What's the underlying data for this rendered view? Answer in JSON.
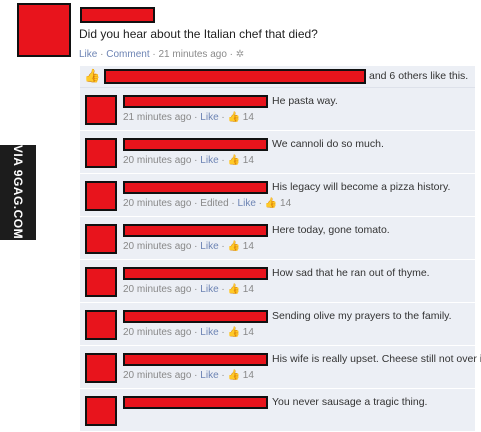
{
  "post": {
    "text": "Did you hear about the Italian chef that died?",
    "like_label": "Like",
    "comment_label": "Comment",
    "time": "21 minutes ago"
  },
  "likes_bar": {
    "others_text": "and 6 others like this."
  },
  "watermark": "VIA 9GAG.COM",
  "comments": [
    {
      "text": "He pasta way.",
      "time": "21 minutes ago",
      "like_label": "Like",
      "like_count": "14"
    },
    {
      "text": "We cannoli do so much.",
      "time": "20 minutes ago",
      "like_label": "Like",
      "like_count": "14"
    },
    {
      "text": "His legacy will become a pizza history.",
      "time": "20 minutes ago",
      "edited": "Edited",
      "like_label": "Like",
      "like_count": "14"
    },
    {
      "text": "Here today, gone tomato.",
      "time": "20 minutes ago",
      "like_label": "Like",
      "like_count": "14"
    },
    {
      "text": "How sad that he ran out of thyme.",
      "time": "20 minutes ago",
      "like_label": "Like",
      "like_count": "14"
    },
    {
      "text": "Sending olive my prayers to the family.",
      "time": "20 minutes ago",
      "like_label": "Like",
      "like_count": "14"
    },
    {
      "text": "His wife is really upset. Cheese still not over it.",
      "time": "20 minutes ago",
      "like_label": "Like",
      "like_count": "14"
    },
    {
      "text": "You never sausage a tragic thing."
    }
  ]
}
